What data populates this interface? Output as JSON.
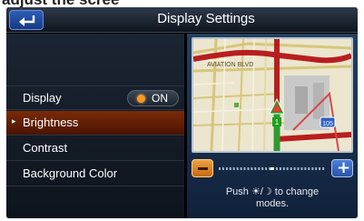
{
  "caption_fragment": "adjust the scree",
  "header": {
    "title": "Display Settings",
    "back_icon": "return-arrow-icon"
  },
  "menu": {
    "items": [
      {
        "label": "Display",
        "toggle": {
          "state": "ON",
          "indicator_color": "#ff9a1e"
        }
      },
      {
        "label": "Brightness",
        "selected": true,
        "marker": "▸"
      },
      {
        "label": "Contrast"
      },
      {
        "label": "Background Color"
      }
    ]
  },
  "preview": {
    "map": {
      "street_label": "AVIATION BLVD",
      "route_shield": "105",
      "route_color": "#b81e1e"
    },
    "slider": {
      "minus_icon": "minus-icon",
      "plus_icon": "plus-icon",
      "plus_label": "+",
      "level_fraction": 0.5
    },
    "hint": {
      "line1": "Push ☀/☽ to change",
      "line2": "modes."
    }
  },
  "colors": {
    "selected_row": "#6a2306",
    "header_bg": "#1a2330",
    "panel_bg": "#1c3552"
  }
}
